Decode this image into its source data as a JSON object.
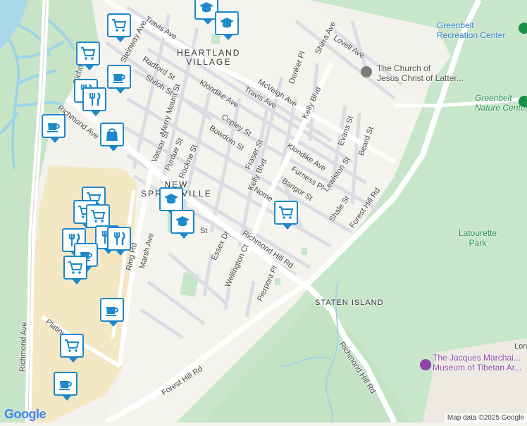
{
  "streets": [
    {
      "id": "travis-ave-1",
      "text": "Travis Ave"
    },
    {
      "id": "travis-ave-2",
      "text": "Travis Ave"
    },
    {
      "id": "steinway-ave",
      "text": "Steinway Ave"
    },
    {
      "id": "radford-st",
      "text": "Radford St"
    },
    {
      "id": "shiloh-st",
      "text": "Shiloh St"
    },
    {
      "id": "merry-mount-st",
      "text": "Merry Mount St"
    },
    {
      "id": "klondike-ave-1",
      "text": "Klondike Ave"
    },
    {
      "id": "klondike-ave-2",
      "text": "Klondike Ave"
    },
    {
      "id": "mcveigh-ave",
      "text": "McVeigh Ave"
    },
    {
      "id": "denker-pl",
      "text": "Denker Pl"
    },
    {
      "id": "kelly-blvd-1",
      "text": "Kelly Blvd"
    },
    {
      "id": "kelly-blvd-2",
      "text": "Kelly Blvd"
    },
    {
      "id": "copley-st",
      "text": "Copley St"
    },
    {
      "id": "bowdoin-st",
      "text": "Bowdoin St"
    },
    {
      "id": "fraser-st",
      "text": "Fraser St"
    },
    {
      "id": "vassar-st",
      "text": "Vassar St"
    },
    {
      "id": "purdue-st",
      "text": "Purdue St"
    },
    {
      "id": "rockne-st",
      "text": "Rockne St"
    },
    {
      "id": "furness-pl",
      "text": "Furness Pl"
    },
    {
      "id": "bangor-st",
      "text": "Bangor St"
    },
    {
      "id": "lewiston-st",
      "text": "Lewiston St"
    },
    {
      "id": "nome-ave",
      "text": "Nome"
    },
    {
      "id": "shale-st",
      "text": "Shale St"
    },
    {
      "id": "evans-st",
      "text": "Evans St"
    },
    {
      "id": "beard-st",
      "text": "Beard St"
    },
    {
      "id": "shirra-ave",
      "text": "Shirra Ave"
    },
    {
      "id": "lovell-ave",
      "text": "Lovell Ave"
    },
    {
      "id": "forest-hill-rd-1",
      "text": "Forest Hill Rd"
    },
    {
      "id": "forest-hill-rd-2",
      "text": "Forest Hill Rd"
    },
    {
      "id": "richmond-hill-rd-1",
      "text": "Richmond Hill Rd"
    },
    {
      "id": "richmond-hill-rd-2",
      "text": "Richmond Hill Rd"
    },
    {
      "id": "essex-dr",
      "text": "Essex Dr"
    },
    {
      "id": "wellington-ct",
      "text": "Wellington Ct"
    },
    {
      "id": "pierpont-pl",
      "text": "Pierpont Pl"
    },
    {
      "id": "marsh-ave",
      "text": "Marsh Ave"
    },
    {
      "id": "ring-rd",
      "text": "Ring Rd"
    },
    {
      "id": "platinum-ave",
      "text": "Platinum Ave"
    },
    {
      "id": "richmond-ave-1",
      "text": "Richmond Ave"
    },
    {
      "id": "richmond-ave-2",
      "text": "Richmond Ave"
    },
    {
      "id": "richmond-ave-3",
      "text": "Richmond"
    },
    {
      "id": "st-fragment",
      "text": "St"
    },
    {
      "id": "lon-fragment",
      "text": "Lon"
    }
  ],
  "areas": {
    "heartland_village": "HEARTLAND\nVILLAGE",
    "new_springville": "NEW\nSPRINGVILLE",
    "staten_island": "STATEN ISLAND"
  },
  "pois": {
    "greenbelt_rec": "Greenbelt\nRecreation Center",
    "church": "The Church of\nJesus Christ of Latter...",
    "greenbelt_nature": "Greenbelt\nNature Center",
    "latourette": "Latourette\nPark",
    "museum": "The Jacques Marchai...\nMuseum of Tibetan Ar..."
  },
  "markers": [
    {
      "id": "school-top",
      "icon": "school"
    },
    {
      "id": "school-heartland",
      "icon": "school"
    },
    {
      "id": "grocery-1",
      "icon": "grocery"
    },
    {
      "id": "grocery-2",
      "icon": "grocery"
    },
    {
      "id": "cafe-1",
      "icon": "cafe"
    },
    {
      "id": "restaurant-1",
      "icon": "restaurant"
    },
    {
      "id": "restaurant-2",
      "icon": "restaurant"
    },
    {
      "id": "cafe-2",
      "icon": "cafe"
    },
    {
      "id": "shopping-1",
      "icon": "shopping"
    },
    {
      "id": "school-springville",
      "icon": "school"
    },
    {
      "id": "school-springville-2",
      "icon": "school"
    },
    {
      "id": "grocery-kelly",
      "icon": "grocery"
    },
    {
      "id": "mall-cluster-1",
      "icon": "grocery"
    },
    {
      "id": "mall-cluster-2",
      "icon": "grocery"
    },
    {
      "id": "mall-cluster-3",
      "icon": "grocery"
    },
    {
      "id": "mall-rest-1",
      "icon": "restaurant"
    },
    {
      "id": "mall-rest-2",
      "icon": "restaurant"
    },
    {
      "id": "mall-rest-3",
      "icon": "restaurant"
    },
    {
      "id": "mall-cafe",
      "icon": "cafe"
    },
    {
      "id": "mall-grocery",
      "icon": "grocery"
    },
    {
      "id": "cafe-ring",
      "icon": "cafe"
    },
    {
      "id": "grocery-platinum",
      "icon": "grocery"
    },
    {
      "id": "cafe-bottom",
      "icon": "cafe"
    }
  ],
  "google_logo": "Google",
  "attribution": "Map data ©2025 Google",
  "colors": {
    "park": "#c8e6c9",
    "water": "#9fd4e8",
    "mall": "#f3e7c4",
    "road": "#ffffff",
    "marker_border": "#1e88c9",
    "poi_blue": "#2a79c4",
    "poi_green": "#1b8f4a",
    "poi_purple": "#8e44ad"
  }
}
